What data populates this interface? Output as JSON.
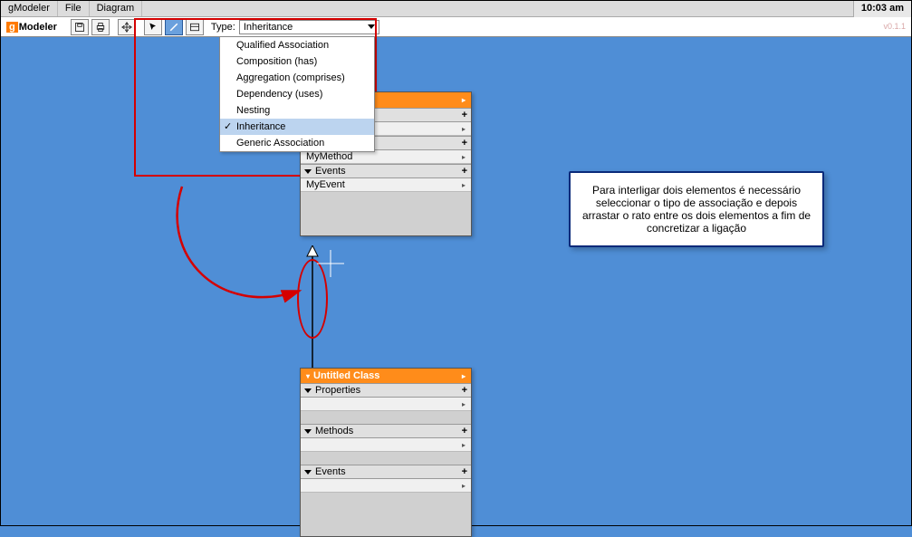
{
  "menubar": {
    "items": [
      "gModeler",
      "File",
      "Diagram"
    ]
  },
  "clock": "10:03 am",
  "logo": {
    "g": "g",
    "rest": "Modeler"
  },
  "toolbar": {
    "type_label": "Type:",
    "type_value": "Inheritance"
  },
  "version": "v0.1.1",
  "dropdown": {
    "items": [
      {
        "label": "Qualified Association",
        "selected": false
      },
      {
        "label": "Composition (has)",
        "selected": false
      },
      {
        "label": "Aggregation (comprises)",
        "selected": false
      },
      {
        "label": "Dependency (uses)",
        "selected": false
      },
      {
        "label": "Nesting",
        "selected": false
      },
      {
        "label": "Inheritance",
        "selected": true
      },
      {
        "label": "Generic Association",
        "selected": false
      }
    ]
  },
  "card1": {
    "rows": {
      "method": "MyMethod",
      "events_hdr": "Events",
      "event": "MyEvent"
    }
  },
  "card2": {
    "title": "Untitled Class",
    "sections": {
      "properties": "Properties",
      "methods": "Methods",
      "events": "Events"
    }
  },
  "callout": "Para interligar dois elementos é necessário seleccionar o tipo de associação e depois arrastar o rato entre os dois elementos a fim de concretizar a ligação"
}
